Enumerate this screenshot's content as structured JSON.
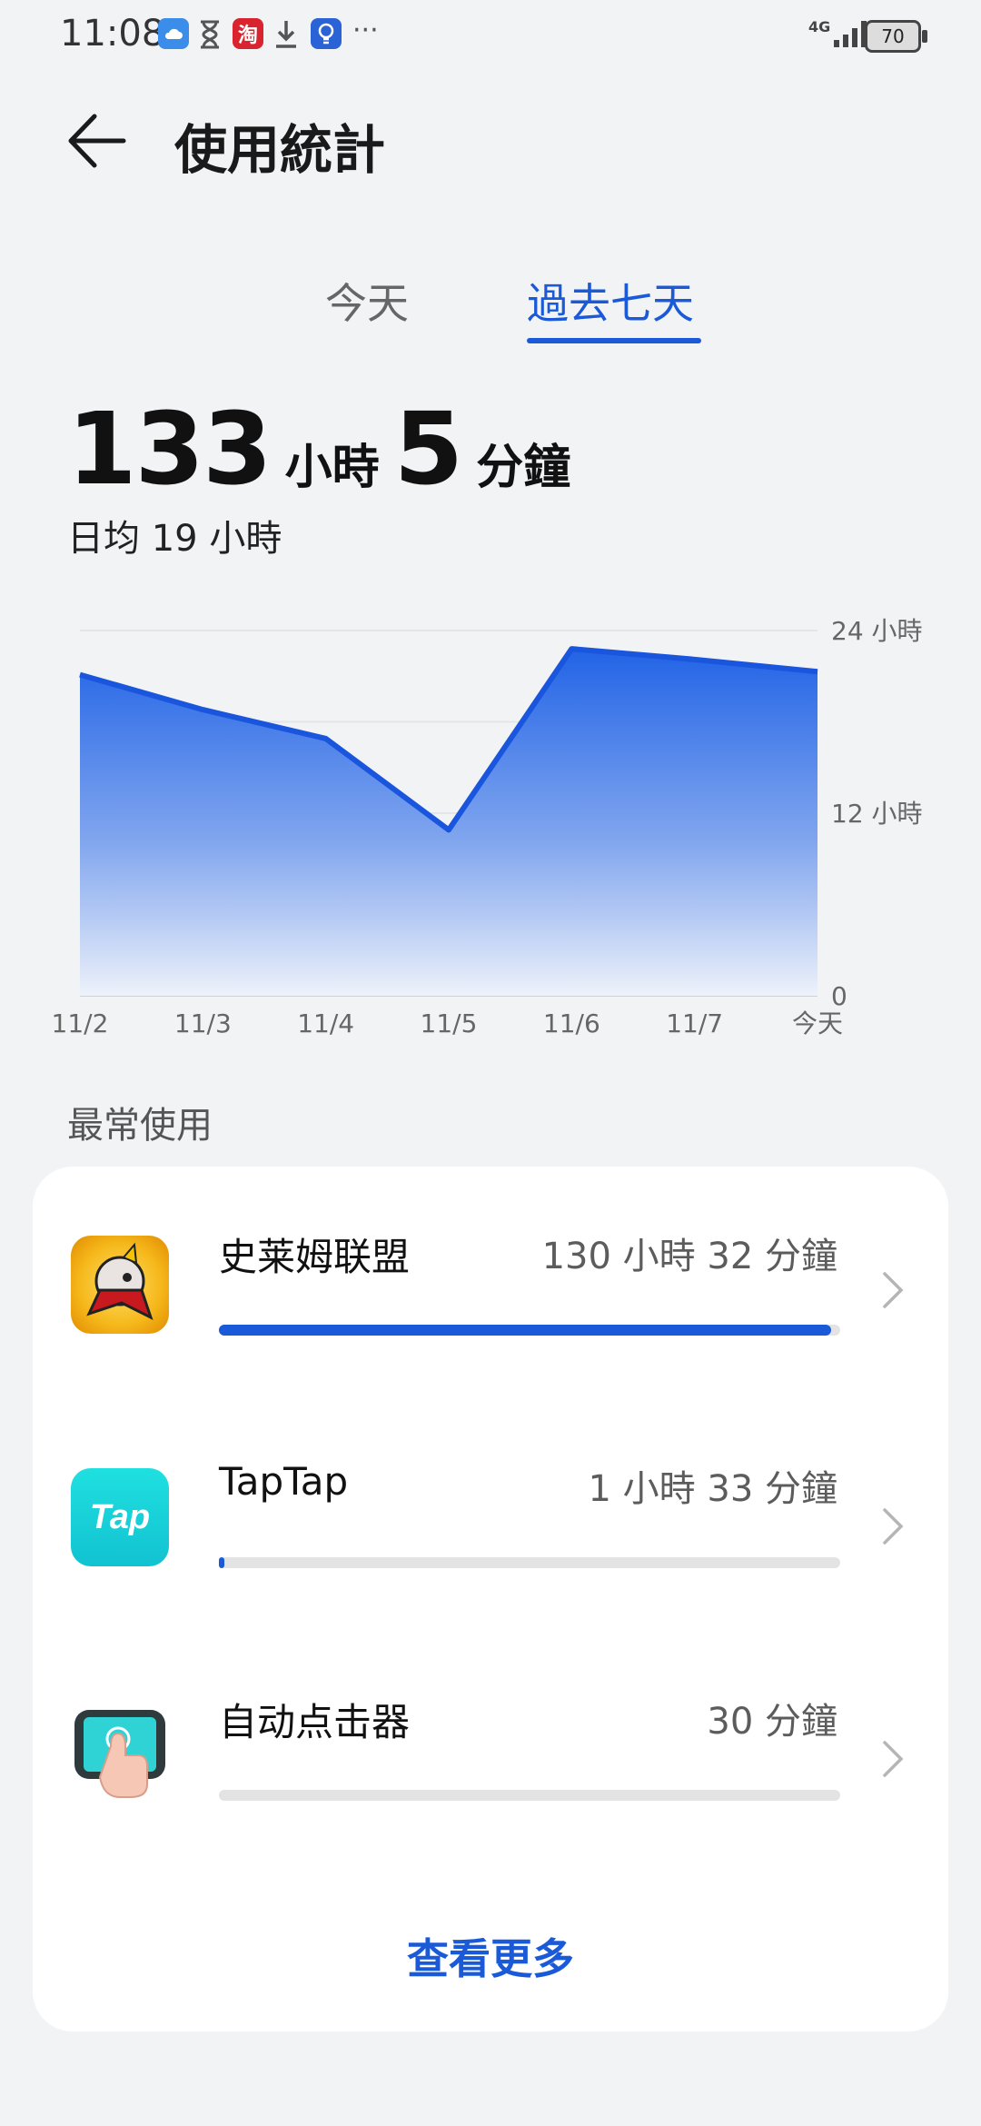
{
  "status_bar": {
    "time": "11:08",
    "network": "4G",
    "battery": "70",
    "icons": [
      "cloud-icon",
      "hourglass-icon",
      "taobao-icon",
      "download-icon",
      "lightbulb-icon",
      "more-icon"
    ],
    "taobao_label": "淘"
  },
  "header": {
    "title": "使用統計"
  },
  "tabs": [
    {
      "label": "今天",
      "active": false
    },
    {
      "label": "過去七天",
      "active": true
    }
  ],
  "summary": {
    "hours": "133",
    "hours_unit": "小時",
    "minutes": "5",
    "minutes_unit": "分鐘",
    "daily_avg": "日均 19 小時"
  },
  "chart_data": {
    "type": "area",
    "categories": [
      "11/2",
      "11/3",
      "11/4",
      "11/5",
      "11/6",
      "11/7",
      "今天"
    ],
    "values": [
      21.1,
      18.8,
      16.9,
      10.9,
      22.8,
      22.1,
      21.3
    ],
    "y_ticks": [
      {
        "value": 24,
        "label": "24 小時"
      },
      {
        "value": 12,
        "label": "12 小時"
      },
      {
        "value": 0,
        "label": "0"
      }
    ],
    "ylim": [
      0,
      24
    ],
    "color": "#2163e6",
    "grid": true
  },
  "section": {
    "most_used": "最常使用"
  },
  "apps": [
    {
      "name": "史莱姆联盟",
      "time": "130 小時 32 分鐘",
      "share": 0.985
    },
    {
      "name": "TapTap",
      "time": "1 小時 33 分鐘",
      "share": 0.008
    },
    {
      "name": "自动点击器",
      "time": "30 分鐘",
      "share": 0.0
    }
  ],
  "taptap_icon_text": "Tap",
  "see_more": "查看更多",
  "colors": {
    "accent": "#1a5ad8",
    "background": "#f1f3f5",
    "card": "#ffffff"
  }
}
